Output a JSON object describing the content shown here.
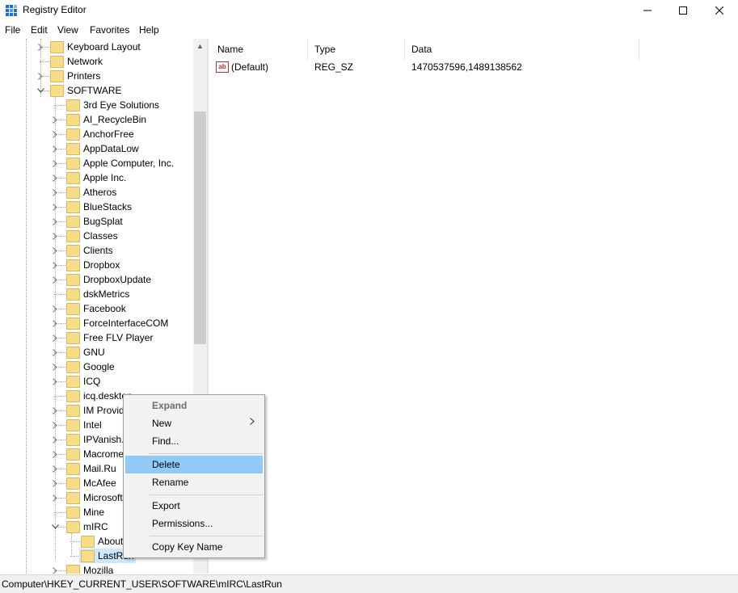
{
  "window": {
    "title": "Registry Editor",
    "minimize_label": "—",
    "maximize_label": "☐",
    "close_label": "✕"
  },
  "menu": {
    "items": [
      "File",
      "Edit",
      "View",
      "Favorites",
      "Help"
    ]
  },
  "tree": {
    "top_nodes": [
      {
        "label": "Keyboard Layout",
        "expander": "collapsed"
      },
      {
        "label": "Network",
        "expander": "none"
      },
      {
        "label": "Printers",
        "expander": "collapsed"
      },
      {
        "label": "SOFTWARE",
        "expander": "expanded"
      }
    ],
    "software_children": [
      {
        "label": "3rd Eye Solutions",
        "expander": "none"
      },
      {
        "label": "AI_RecycleBin",
        "expander": "collapsed"
      },
      {
        "label": "AnchorFree",
        "expander": "collapsed"
      },
      {
        "label": "AppDataLow",
        "expander": "collapsed"
      },
      {
        "label": "Apple Computer, Inc.",
        "expander": "collapsed"
      },
      {
        "label": "Apple Inc.",
        "expander": "collapsed"
      },
      {
        "label": "Atheros",
        "expander": "collapsed"
      },
      {
        "label": "BlueStacks",
        "expander": "collapsed"
      },
      {
        "label": "BugSplat",
        "expander": "collapsed"
      },
      {
        "label": "Classes",
        "expander": "collapsed"
      },
      {
        "label": "Clients",
        "expander": "collapsed"
      },
      {
        "label": "Dropbox",
        "expander": "collapsed"
      },
      {
        "label": "DropboxUpdate",
        "expander": "collapsed"
      },
      {
        "label": "dskMetrics",
        "expander": "none"
      },
      {
        "label": "Facebook",
        "expander": "collapsed"
      },
      {
        "label": "ForceInterfaceCOM",
        "expander": "collapsed"
      },
      {
        "label": "Free FLV Player",
        "expander": "collapsed"
      },
      {
        "label": "GNU",
        "expander": "collapsed"
      },
      {
        "label": "Google",
        "expander": "collapsed"
      },
      {
        "label": "ICQ",
        "expander": "collapsed"
      },
      {
        "label": "icq.desktop",
        "expander": "none"
      },
      {
        "label": "IM Providers",
        "expander": "collapsed"
      },
      {
        "label": "Intel",
        "expander": "collapsed"
      },
      {
        "label": "IPVanish.com",
        "expander": "collapsed"
      },
      {
        "label": "Macromedia",
        "expander": "collapsed"
      },
      {
        "label": "Mail.Ru",
        "expander": "collapsed"
      },
      {
        "label": "McAfee",
        "expander": "collapsed"
      },
      {
        "label": "Microsoft",
        "expander": "collapsed"
      },
      {
        "label": "Mine",
        "expander": "none"
      },
      {
        "label": "mIRC",
        "expander": "expanded"
      }
    ],
    "mirc_children": [
      {
        "label": "About"
      },
      {
        "label": "LastRun",
        "selected": true
      }
    ],
    "after_nodes": [
      {
        "label": "Mozilla",
        "expander": "collapsed"
      }
    ]
  },
  "list": {
    "columns": [
      "Name",
      "Type",
      "Data"
    ],
    "rows": [
      {
        "name": "(Default)",
        "type": "REG_SZ",
        "data": "1470537596,1489138562",
        "icon": "string-value-icon"
      }
    ]
  },
  "context_menu": {
    "items": [
      {
        "label": "Expand",
        "disabled": true
      },
      {
        "label": "New",
        "submenu": true
      },
      {
        "label": "Find..."
      },
      {
        "separator": true
      },
      {
        "label": "Delete",
        "highlighted": true
      },
      {
        "label": "Rename"
      },
      {
        "separator": true
      },
      {
        "label": "Export"
      },
      {
        "label": "Permissions..."
      },
      {
        "separator": true
      },
      {
        "label": "Copy Key Name"
      }
    ]
  },
  "status": {
    "path": "Computer\\HKEY_CURRENT_USER\\SOFTWARE\\mIRC\\LastRun"
  },
  "colors": {
    "selection": "#cce8ff",
    "menu_highlight": "#91c9f7",
    "folder": "#f8dc88"
  }
}
